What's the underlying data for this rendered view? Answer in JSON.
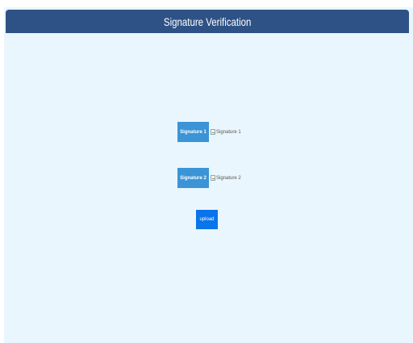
{
  "header": {
    "title": "Signature Verification"
  },
  "signatures": [
    {
      "button_label": "Signature 1",
      "image_alt": "Signature 1"
    },
    {
      "button_label": "Signature 2",
      "image_alt": "Signature 2"
    }
  ],
  "upload": {
    "label": "upload"
  },
  "colors": {
    "header_bg": "#2e5286",
    "page_bg": "#eaf6fd",
    "signature_button": "#3a94d6",
    "upload_button": "#0a74ea"
  }
}
